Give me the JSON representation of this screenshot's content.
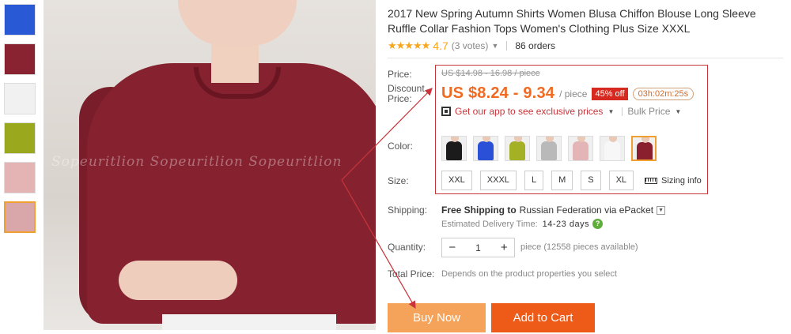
{
  "thumbnails": [
    {
      "name": "thumb-blue",
      "color": "#2a59d6"
    },
    {
      "name": "thumb-red",
      "color": "#8a2331"
    },
    {
      "name": "thumb-white",
      "color": "#f1f1f1"
    },
    {
      "name": "thumb-olive",
      "color": "#9aa81e"
    },
    {
      "name": "thumb-pink",
      "color": "#e4b4b4"
    },
    {
      "name": "thumb-pink-selected",
      "color": "#d9a6a9",
      "selected": true
    }
  ],
  "main_image": {
    "watermark": "Sopeuritlion  Sopeuritlion  Sopeuritlion"
  },
  "product": {
    "title": "2017 New Spring Autumn Shirts Women Blusa Chiffon Blouse Long Sleeve Ruffle Collar Fashion Tops Women's Clothing Plus Size XXXL",
    "stars": "★★★★★",
    "rating": "4.7",
    "votes": "(3 votes)",
    "orders": "86 orders"
  },
  "labels": {
    "price": "Price:",
    "discount_price": "Discount\nPrice:",
    "color": "Color:",
    "size": "Size:",
    "shipping": "Shipping:",
    "quantity": "Quantity:",
    "total_price": "Total Price:"
  },
  "pricing": {
    "original": "US $14.98 - 16.98 / piece",
    "discount": "US $8.24 - 9.34",
    "unit": "/ piece",
    "off": "45% off",
    "countdown": "03h:02m:25s"
  },
  "app_promo": {
    "text": "Get our app to see exclusive prices",
    "bulk": "Bulk Price"
  },
  "colors": [
    {
      "name": "black",
      "shirt": "#1b1b1b"
    },
    {
      "name": "blue",
      "shirt": "#2a50d8"
    },
    {
      "name": "olive",
      "shirt": "#a5b125"
    },
    {
      "name": "gray",
      "shirt": "#b9b9b9"
    },
    {
      "name": "pink",
      "shirt": "#e3b5b7"
    },
    {
      "name": "white",
      "shirt": "#f7f7f7"
    },
    {
      "name": "wine-red",
      "shirt": "#8a1f2d",
      "selected": true
    }
  ],
  "sizes": [
    "XXL",
    "XXXL",
    "L",
    "M",
    "S",
    "XL"
  ],
  "sizing_info": "Sizing info",
  "shipping": {
    "bold": "Free Shipping to",
    "rest": "Russian Federation via ePacket",
    "delivery_label": "Estimated Delivery Time:",
    "delivery_days": "14-23 days"
  },
  "quantity": {
    "value": "1",
    "minus": "−",
    "plus": "+",
    "note": "piece (12558 pieces available)"
  },
  "total": {
    "note": "Depends on the product properties you select"
  },
  "buttons": {
    "buy_now": "Buy Now",
    "add_to_cart": "Add to Cart"
  },
  "accent_colors": {
    "price": "#f16a22",
    "highlight_box": "#c9343a",
    "buy_now": "#f5a35a",
    "add_to_cart": "#ee5a17"
  }
}
